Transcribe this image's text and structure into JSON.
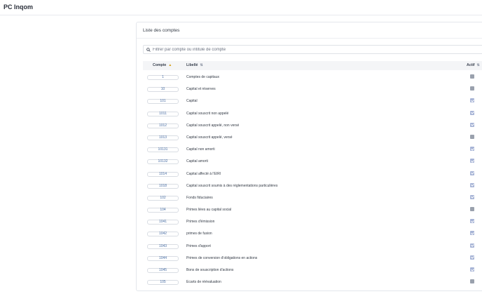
{
  "app": {
    "title": "PC Inqom"
  },
  "panel": {
    "title": "Liste des comptes"
  },
  "filter": {
    "placeholder": "Filtrer par compte ou intitulé de compte",
    "value": ""
  },
  "table": {
    "headers": {
      "compte": "Compte",
      "libelle": "Libellé",
      "actif": "Actif"
    },
    "sort": {
      "compte": "asc",
      "libelle": "none",
      "actif": "none"
    },
    "rows": [
      {
        "code": "1",
        "label": "Comptes de capitaux",
        "active": false
      },
      {
        "code": "10",
        "label": "Capital et réserves",
        "active": false
      },
      {
        "code": "101",
        "label": "Capital",
        "active": true
      },
      {
        "code": "1011",
        "label": "Capital souscrit non appelé",
        "active": true
      },
      {
        "code": "1012",
        "label": "Capital souscrit appelé, non versé",
        "active": true
      },
      {
        "code": "1013",
        "label": "Capital souscrit appelé, versé",
        "active": false
      },
      {
        "code": "10131",
        "label": "Capital non amorti",
        "active": true
      },
      {
        "code": "10132",
        "label": "Capital amorti",
        "active": true
      },
      {
        "code": "1014",
        "label": "Capital affecté à l'EIRl",
        "active": true
      },
      {
        "code": "1018",
        "label": "Capital souscrit soumis à des réglementations particulières",
        "active": true
      },
      {
        "code": "102",
        "label": "Fonds fiduciaires",
        "active": true
      },
      {
        "code": "104",
        "label": "Primes liées au capital social",
        "active": false
      },
      {
        "code": "1041",
        "label": "Primes d'émission",
        "active": true
      },
      {
        "code": "1042",
        "label": "primes de fusion",
        "active": true
      },
      {
        "code": "1043",
        "label": "Primes d'apport",
        "active": true
      },
      {
        "code": "1044",
        "label": "Primes de conversion d'obligations en actions",
        "active": true
      },
      {
        "code": "1045",
        "label": "Bons de souscription d'actions",
        "active": true
      },
      {
        "code": "105",
        "label": "Ecarts de réévaluation",
        "active": false
      }
    ]
  }
}
